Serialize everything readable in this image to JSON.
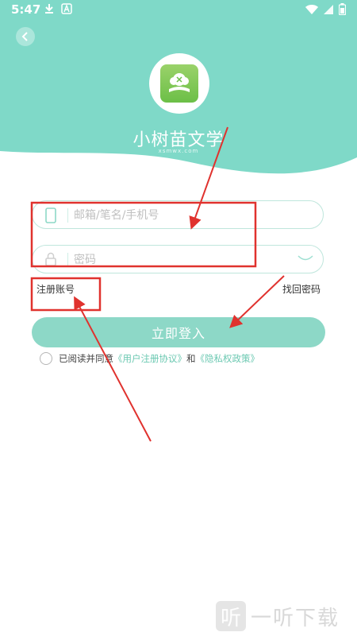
{
  "status_bar": {
    "time": "5:47"
  },
  "header": {
    "app_name": "小树苗文学",
    "app_subtitle": "xsmwx.com",
    "background_color": "#7fd9c8"
  },
  "form": {
    "email_placeholder": "邮箱/笔名/手机号",
    "password_placeholder": "密码",
    "register_label": "注册账号",
    "forgot_label": "找回密码",
    "login_label": "立即登入",
    "agreement": {
      "prefix": "已阅读并同意",
      "user_agreement": "《用户注册协议》",
      "conjunction": "和",
      "privacy_policy": "《隐私权政策》"
    }
  },
  "watermark": {
    "icon_char": "听",
    "text": "一听下载"
  },
  "colors": {
    "accent": "#8dd8c7",
    "link": "#6cc9b2",
    "annotation": "#e0322e"
  }
}
